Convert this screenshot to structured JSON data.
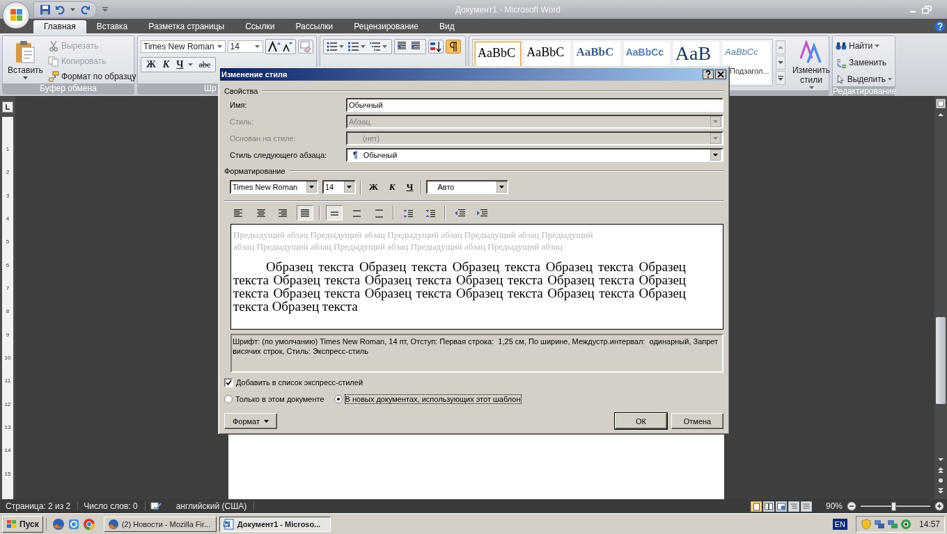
{
  "window": {
    "title": "Документ1 - Microsoft Word"
  },
  "tabs": [
    {
      "label": "Главная",
      "selected": true
    },
    {
      "label": "Вставка",
      "selected": false
    },
    {
      "label": "Разметка страницы",
      "selected": false
    },
    {
      "label": "Ссылки",
      "selected": false
    },
    {
      "label": "Рассылки",
      "selected": false
    },
    {
      "label": "Рецензирование",
      "selected": false
    },
    {
      "label": "Вид",
      "selected": false
    }
  ],
  "clipboard": {
    "label": "Буфер обмена",
    "paste": "Вставить",
    "commands": [
      {
        "kind": "cut",
        "label": "Вырезать",
        "disabled": true
      },
      {
        "kind": "copy",
        "label": "Копировать",
        "disabled": true
      },
      {
        "kind": "painter",
        "label": "Формат по образцу",
        "disabled": false
      }
    ]
  },
  "font_group": {
    "label": "Шр",
    "font": "Times New Roman",
    "size": "14",
    "format_buttons": [
      {
        "kind": "bold",
        "label": "Ж"
      },
      {
        "kind": "italic",
        "label": "К"
      },
      {
        "kind": "underline",
        "label": "Ч"
      },
      {
        "kind": "strike",
        "label": "abc"
      }
    ]
  },
  "paragraph_group": {
    "show_marks": {
      "on": true
    }
  },
  "styles_group": {
    "gallery": [
      {
        "kind": "normal",
        "sample": "AaBbC",
        "selected": true
      },
      {
        "kind": "nospacing",
        "sample": "AaBbC",
        "selected": false
      },
      {
        "kind": "heading1",
        "sample": "AaBbC",
        "selected": false
      },
      {
        "kind": "heading2",
        "sample": "AaBbCc",
        "selected": false
      },
      {
        "kind": "title",
        "sample": "AaB",
        "selected": false
      },
      {
        "kind": "subtitle",
        "sample": "AaBbCc",
        "caption": "Подзагол...",
        "selected": false
      }
    ],
    "change_styles": "Изменить стили"
  },
  "editing_group": {
    "label": "Редактирование",
    "commands": [
      {
        "kind": "find",
        "label": "Найти"
      },
      {
        "kind": "replace",
        "label": "Заменить"
      },
      {
        "kind": "select",
        "label": "Выделить"
      }
    ]
  },
  "ruler_numbers": [
    "1",
    "2",
    "3",
    "4",
    "5",
    "6",
    "7",
    "8",
    "9",
    "10",
    "11",
    "12",
    "13",
    "14",
    "15"
  ],
  "dialog": {
    "title": "Изменение стиля",
    "properties": {
      "heading": "Свойства",
      "rows": [
        {
          "kind": "text",
          "label": "Имя:",
          "value": "Обычный",
          "disabled": false
        },
        {
          "kind": "dropdown",
          "label": "Стиль:",
          "value": "Абзац",
          "disabled": true
        },
        {
          "kind": "dropdown",
          "label": "Основан на стиле:",
          "value": "(нет)",
          "disabled": true
        },
        {
          "kind": "dropdown",
          "label": "Стиль следующего абзаца:",
          "marker": "¶",
          "value": "Обычный",
          "disabled": false
        }
      ]
    },
    "formatting": {
      "heading": "Форматирование",
      "font": "Times New Roman",
      "size": "14",
      "font_color": "Авто",
      "buttons": [
        {
          "kind": "bold",
          "label": "Ж"
        },
        {
          "kind": "italic",
          "label": "К"
        },
        {
          "kind": "underline",
          "label": "Ч"
        }
      ],
      "alignment": [
        {
          "kind": "left",
          "selected": false
        },
        {
          "kind": "center",
          "selected": false
        },
        {
          "kind": "right",
          "selected": false
        },
        {
          "kind": "justify",
          "selected": true
        }
      ],
      "line_spacing": [
        {
          "kind": "single",
          "selected": true
        },
        {
          "kind": "one-half",
          "selected": false
        },
        {
          "kind": "double",
          "selected": false
        }
      ],
      "spacing": [
        {
          "kind": "increase"
        },
        {
          "kind": "decrease"
        }
      ],
      "indent": [
        {
          "kind": "decrease"
        },
        {
          "kind": "increase"
        }
      ]
    },
    "preview": {
      "previous": "Предыдущий абзац Предыдущий абзац Предыдущий абзац Предыдущий абзац Предыдущий абзац Предыдущий абзац Предыдущий абзац Предыдущий абзац Предыдущий абзац",
      "sample": "Образец текста Образец текста Образец текста Образец текста Образец текста Образец текста Образец текста Образец текста Образец текста Образец текста Образец текста Образец текста Образец текста Образец текста Образец текста Образец текста"
    },
    "description": "Шрифт: (по умолчанию) Times New Roman, 14 пт, Отступ: Первая строка:  1,25 см, По ширине, Междустр.интервал:  одинарный, Запрет висячих строк, Стиль: Экспресс-стиль",
    "add_to_quick": {
      "label": "Добавить в список экспресс-стилей",
      "checked": true
    },
    "scope": [
      {
        "label": "Только в этом документе",
        "selected": false
      },
      {
        "label": "В новых документах, использующих этот шаблон",
        "selected": true
      }
    ],
    "format_button": "Формат",
    "ok": "ОК",
    "cancel": "Отмена"
  },
  "status_bar": {
    "page": "Страница: 2 из 2",
    "words": "Число слов: 0",
    "language": "английский (США)",
    "views": [
      {
        "kind": "print",
        "selected": true
      },
      {
        "kind": "reading",
        "selected": false
      },
      {
        "kind": "web",
        "selected": false
      },
      {
        "kind": "outline",
        "selected": false
      },
      {
        "kind": "draft",
        "selected": false
      }
    ],
    "zoom": "90%",
    "zoom_slider": {
      "level": 0.47
    }
  },
  "taskbar": {
    "start": "Пуск",
    "tasks": [
      {
        "kind": "browser",
        "label": "(2) Новости - Mozilla Fir...",
        "selected": false
      },
      {
        "kind": "word",
        "label": "Документ1 - Microso...",
        "selected": true
      }
    ],
    "language": "EN",
    "clock": "14:57"
  }
}
